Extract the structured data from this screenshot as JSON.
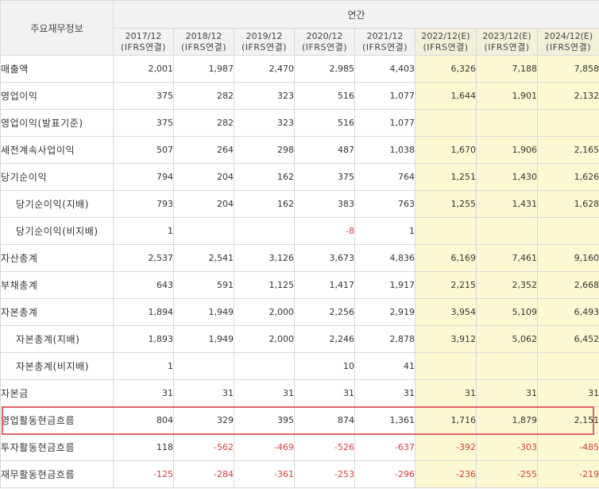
{
  "header": {
    "corner": "주요재무정보",
    "group": "연간",
    "columns": [
      {
        "period": "2017/12",
        "basis": "(IFRS연결)",
        "estimate": false
      },
      {
        "period": "2018/12",
        "basis": "(IFRS연결)",
        "estimate": false
      },
      {
        "period": "2019/12",
        "basis": "(IFRS연결)",
        "estimate": false
      },
      {
        "period": "2020/12",
        "basis": "(IFRS연결)",
        "estimate": false
      },
      {
        "period": "2021/12",
        "basis": "(IFRS연결)",
        "estimate": false
      },
      {
        "period": "2022/12(E)",
        "basis": "(IFRS연결)",
        "estimate": true
      },
      {
        "period": "2023/12(E)",
        "basis": "(IFRS연결)",
        "estimate": true
      },
      {
        "period": "2024/12(E)",
        "basis": "(IFRS연결)",
        "estimate": true
      }
    ]
  },
  "rows": [
    {
      "label": "매출액",
      "indent": false,
      "values": [
        "2,001",
        "1,987",
        "2,470",
        "2,985",
        "4,403",
        "6,326",
        "7,188",
        "7,858"
      ]
    },
    {
      "label": "영업이익",
      "indent": false,
      "values": [
        "375",
        "282",
        "323",
        "516",
        "1,077",
        "1,644",
        "1,901",
        "2,132"
      ]
    },
    {
      "label": "영업이익(발표기준)",
      "indent": false,
      "values": [
        "375",
        "282",
        "323",
        "516",
        "1,077",
        "",
        "",
        ""
      ]
    },
    {
      "label": "세전계속사업이익",
      "indent": false,
      "values": [
        "507",
        "264",
        "298",
        "487",
        "1,038",
        "1,670",
        "1,906",
        "2,165"
      ]
    },
    {
      "label": "당기순이익",
      "indent": false,
      "values": [
        "794",
        "204",
        "162",
        "375",
        "764",
        "1,251",
        "1,430",
        "1,626"
      ]
    },
    {
      "label": "당기순이익(지배)",
      "indent": true,
      "values": [
        "793",
        "204",
        "162",
        "383",
        "763",
        "1,255",
        "1,431",
        "1,628"
      ]
    },
    {
      "label": "당기순이익(비지배)",
      "indent": true,
      "values": [
        "1",
        "",
        "",
        "-8",
        "1",
        "",
        "",
        ""
      ]
    },
    {
      "label": "자산총계",
      "indent": false,
      "values": [
        "2,537",
        "2,541",
        "3,126",
        "3,673",
        "4,836",
        "6,169",
        "7,461",
        "9,160"
      ]
    },
    {
      "label": "부채총계",
      "indent": false,
      "values": [
        "643",
        "591",
        "1,125",
        "1,417",
        "1,917",
        "2,215",
        "2,352",
        "2,668"
      ]
    },
    {
      "label": "자본총계",
      "indent": false,
      "values": [
        "1,894",
        "1,949",
        "2,000",
        "2,256",
        "2,919",
        "3,954",
        "5,109",
        "6,493"
      ]
    },
    {
      "label": "자본총계(지배)",
      "indent": true,
      "values": [
        "1,893",
        "1,949",
        "2,000",
        "2,246",
        "2,878",
        "3,912",
        "5,062",
        "6,452"
      ]
    },
    {
      "label": "자본총계(비지배)",
      "indent": true,
      "values": [
        "1",
        "",
        "",
        "10",
        "41",
        "",
        "",
        ""
      ]
    },
    {
      "label": "자본금",
      "indent": false,
      "values": [
        "31",
        "31",
        "31",
        "31",
        "31",
        "31",
        "31",
        "31"
      ]
    },
    {
      "label": "영업활동현금흐름",
      "indent": false,
      "highlight": true,
      "values": [
        "804",
        "329",
        "395",
        "874",
        "1,361",
        "1,716",
        "1,879",
        "2,151"
      ]
    },
    {
      "label": "투자활동현금흐름",
      "indent": false,
      "values": [
        "118",
        "-562",
        "-469",
        "-526",
        "-637",
        "-392",
        "-303",
        "-485"
      ]
    },
    {
      "label": "재무활동현금흐름",
      "indent": false,
      "values": [
        "-125",
        "-284",
        "-361",
        "-253",
        "-296",
        "-236",
        "-255",
        "-219"
      ]
    }
  ],
  "colors": {
    "negative": "#d33d3d",
    "estimate_bg": "#fcf9d2",
    "header_bg": "#f2f2f2",
    "highlight_border": "#e06666"
  }
}
